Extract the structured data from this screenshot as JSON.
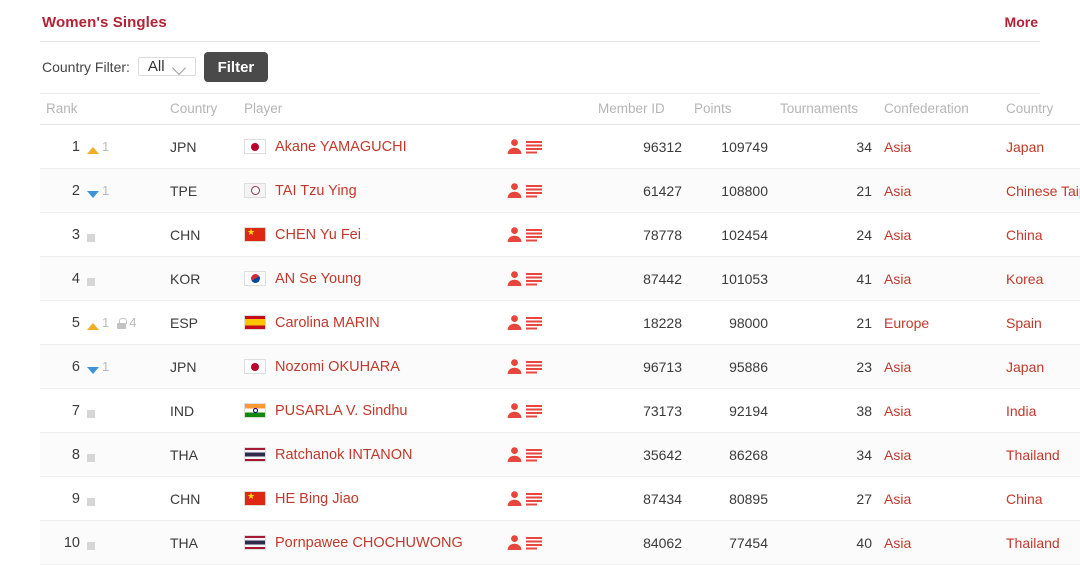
{
  "header": {
    "title": "Women's Singles",
    "more_label": "More"
  },
  "filter": {
    "label": "Country Filter:",
    "selected": "All",
    "options": [
      "All"
    ],
    "button_label": "Filter",
    "chevron_icon": "chevron-down-icon"
  },
  "table": {
    "columns": [
      "Rank",
      "Country",
      "Player",
      "",
      "Member ID",
      "Points",
      "Tournaments",
      "Confederation",
      "Country"
    ],
    "icons": {
      "profile": "person-profile-icon",
      "bio": "list-lines-icon",
      "up": "triangle-up-icon",
      "down": "triangle-down-icon",
      "flat": "square-flat-icon",
      "lock": "lock-icon"
    },
    "rows": [
      {
        "rank": "1",
        "change_dir": "up",
        "change_val": "1",
        "locked": false,
        "lock_val": "",
        "abbr": "JPN",
        "flag": "f-jpn",
        "player": "Akane YAMAGUCHI",
        "member_id": "96312",
        "points": "109749",
        "tournaments": "34",
        "confederation": "Asia",
        "country": "Japan"
      },
      {
        "rank": "2",
        "change_dir": "down",
        "change_val": "1",
        "locked": false,
        "lock_val": "",
        "abbr": "TPE",
        "flag": "f-tpe",
        "player": "TAI Tzu Ying",
        "member_id": "61427",
        "points": "108800",
        "tournaments": "21",
        "confederation": "Asia",
        "country": "Chinese Taipei"
      },
      {
        "rank": "3",
        "change_dir": "flat",
        "change_val": "",
        "locked": false,
        "lock_val": "",
        "abbr": "CHN",
        "flag": "f-chn",
        "player": "CHEN Yu Fei",
        "member_id": "78778",
        "points": "102454",
        "tournaments": "24",
        "confederation": "Asia",
        "country": "China"
      },
      {
        "rank": "4",
        "change_dir": "flat",
        "change_val": "",
        "locked": false,
        "lock_val": "",
        "abbr": "KOR",
        "flag": "f-kor",
        "player": "AN Se Young",
        "member_id": "87442",
        "points": "101053",
        "tournaments": "41",
        "confederation": "Asia",
        "country": "Korea"
      },
      {
        "rank": "5",
        "change_dir": "up",
        "change_val": "1",
        "locked": true,
        "lock_val": "4",
        "abbr": "ESP",
        "flag": "f-esp",
        "player": "Carolina MARIN",
        "member_id": "18228",
        "points": "98000",
        "tournaments": "21",
        "confederation": "Europe",
        "country": "Spain"
      },
      {
        "rank": "6",
        "change_dir": "down",
        "change_val": "1",
        "locked": false,
        "lock_val": "",
        "abbr": "JPN",
        "flag": "f-jpn",
        "player": "Nozomi OKUHARA",
        "member_id": "96713",
        "points": "95886",
        "tournaments": "23",
        "confederation": "Asia",
        "country": "Japan"
      },
      {
        "rank": "7",
        "change_dir": "flat",
        "change_val": "",
        "locked": false,
        "lock_val": "",
        "abbr": "IND",
        "flag": "f-ind",
        "player": "PUSARLA V. Sindhu",
        "member_id": "73173",
        "points": "92194",
        "tournaments": "38",
        "confederation": "Asia",
        "country": "India"
      },
      {
        "rank": "8",
        "change_dir": "flat",
        "change_val": "",
        "locked": false,
        "lock_val": "",
        "abbr": "THA",
        "flag": "f-tha",
        "player": "Ratchanok INTANON",
        "member_id": "35642",
        "points": "86268",
        "tournaments": "34",
        "confederation": "Asia",
        "country": "Thailand"
      },
      {
        "rank": "9",
        "change_dir": "flat",
        "change_val": "",
        "locked": false,
        "lock_val": "",
        "abbr": "CHN",
        "flag": "f-chn",
        "player": "HE Bing Jiao",
        "member_id": "87434",
        "points": "80895",
        "tournaments": "27",
        "confederation": "Asia",
        "country": "China"
      },
      {
        "rank": "10",
        "change_dir": "flat",
        "change_val": "",
        "locked": false,
        "lock_val": "",
        "abbr": "THA",
        "flag": "f-tha",
        "player": "Pornpawee CHOCHUWONG",
        "member_id": "84062",
        "points": "77454",
        "tournaments": "40",
        "confederation": "Asia",
        "country": "Thailand"
      }
    ]
  },
  "colors": {
    "accent_red": "#b22234",
    "link_red": "#c0392b",
    "up_arrow": "#f0ad24",
    "down_arrow": "#3d93d8",
    "flat_square": "#d6d6d6",
    "filter_button": "#4a4a4a"
  }
}
